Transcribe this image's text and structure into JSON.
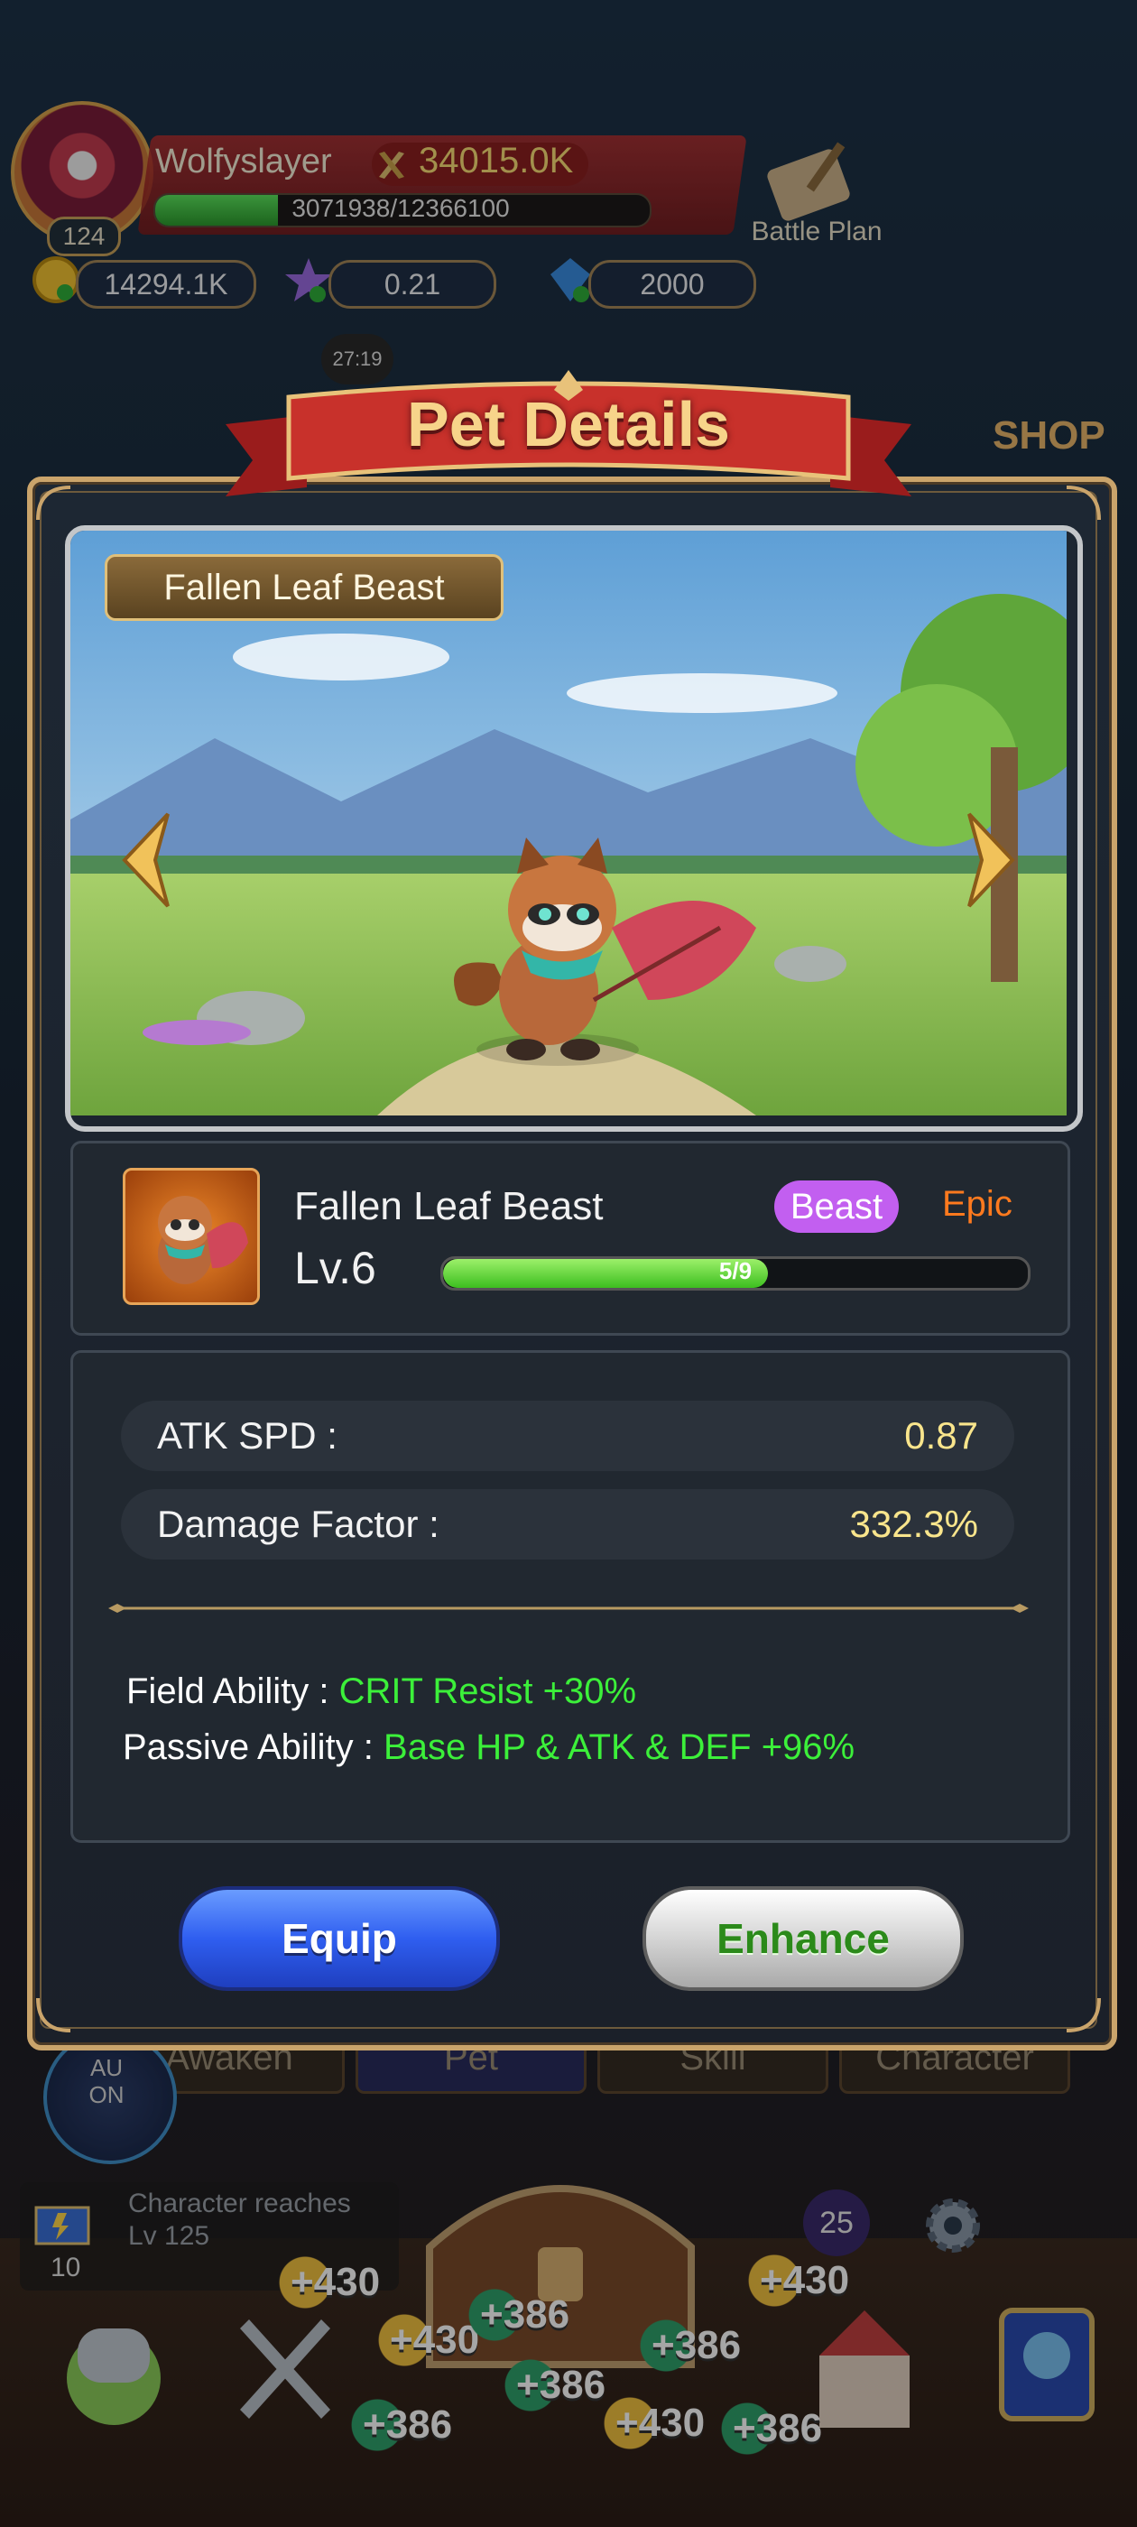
{
  "hud": {
    "player_level": "124",
    "player_name": "Wolfyslayer",
    "combat_power": "34015.0K",
    "xp_text": "3071938/12366100",
    "xp_progress": 0.248,
    "battle_plan_label": "Battle Plan",
    "gold": "14294.1K",
    "gem_rate": "0.21",
    "crystals": "2000",
    "timer": "27:19",
    "shop_label": "SHOP"
  },
  "modal": {
    "title": "Pet Details",
    "pet_name_tag": "Fallen Leaf Beast",
    "pet": {
      "name": "Fallen Leaf Beast",
      "level": "Lv.6",
      "type_badge": "Beast",
      "rarity": "Epic",
      "progress_text": "5/9",
      "progress": 0.556
    },
    "stats": [
      {
        "label": "ATK SPD :",
        "value": "0.87"
      },
      {
        "label": "Damage Factor :",
        "value": "332.3%"
      }
    ],
    "abilities": [
      {
        "label": "Field Ability :",
        "value": "CRIT Resist +30%"
      },
      {
        "label": "Passive Ability :",
        "value": "Base HP & ATK & DEF +96%"
      }
    ],
    "equip_label": "Equip",
    "enhance_label": "Enhance"
  },
  "background": {
    "tabs": [
      "Awaken",
      "Pet",
      "Skill",
      "Character"
    ],
    "auto_label": "AU\nON",
    "quest_text_line1": "Character reaches",
    "quest_text_line2": "Lv 125",
    "quest_number": "10",
    "badge_count": "25",
    "coin_rewards": [
      "+430",
      "+430",
      "+386",
      "+386",
      "+430",
      "+386",
      "+386",
      "+430",
      "+386"
    ]
  },
  "colors": {
    "gold_border": "#caa46b",
    "ability_green": "#3cf03a",
    "stat_value_yellow": "#f9e58c",
    "rarity_epic": "#ff7a1e",
    "beast_badge": "#c25ff0",
    "equip_blue": "#2f5ef0"
  },
  "icons": [
    "combat-power-icon",
    "gold-coin-icon",
    "star-gem-icon",
    "crystal-icon",
    "battle-plan-scroll-icon",
    "prev-arrow-icon",
    "next-arrow-icon",
    "gear-icon",
    "quest-flag-icon"
  ]
}
